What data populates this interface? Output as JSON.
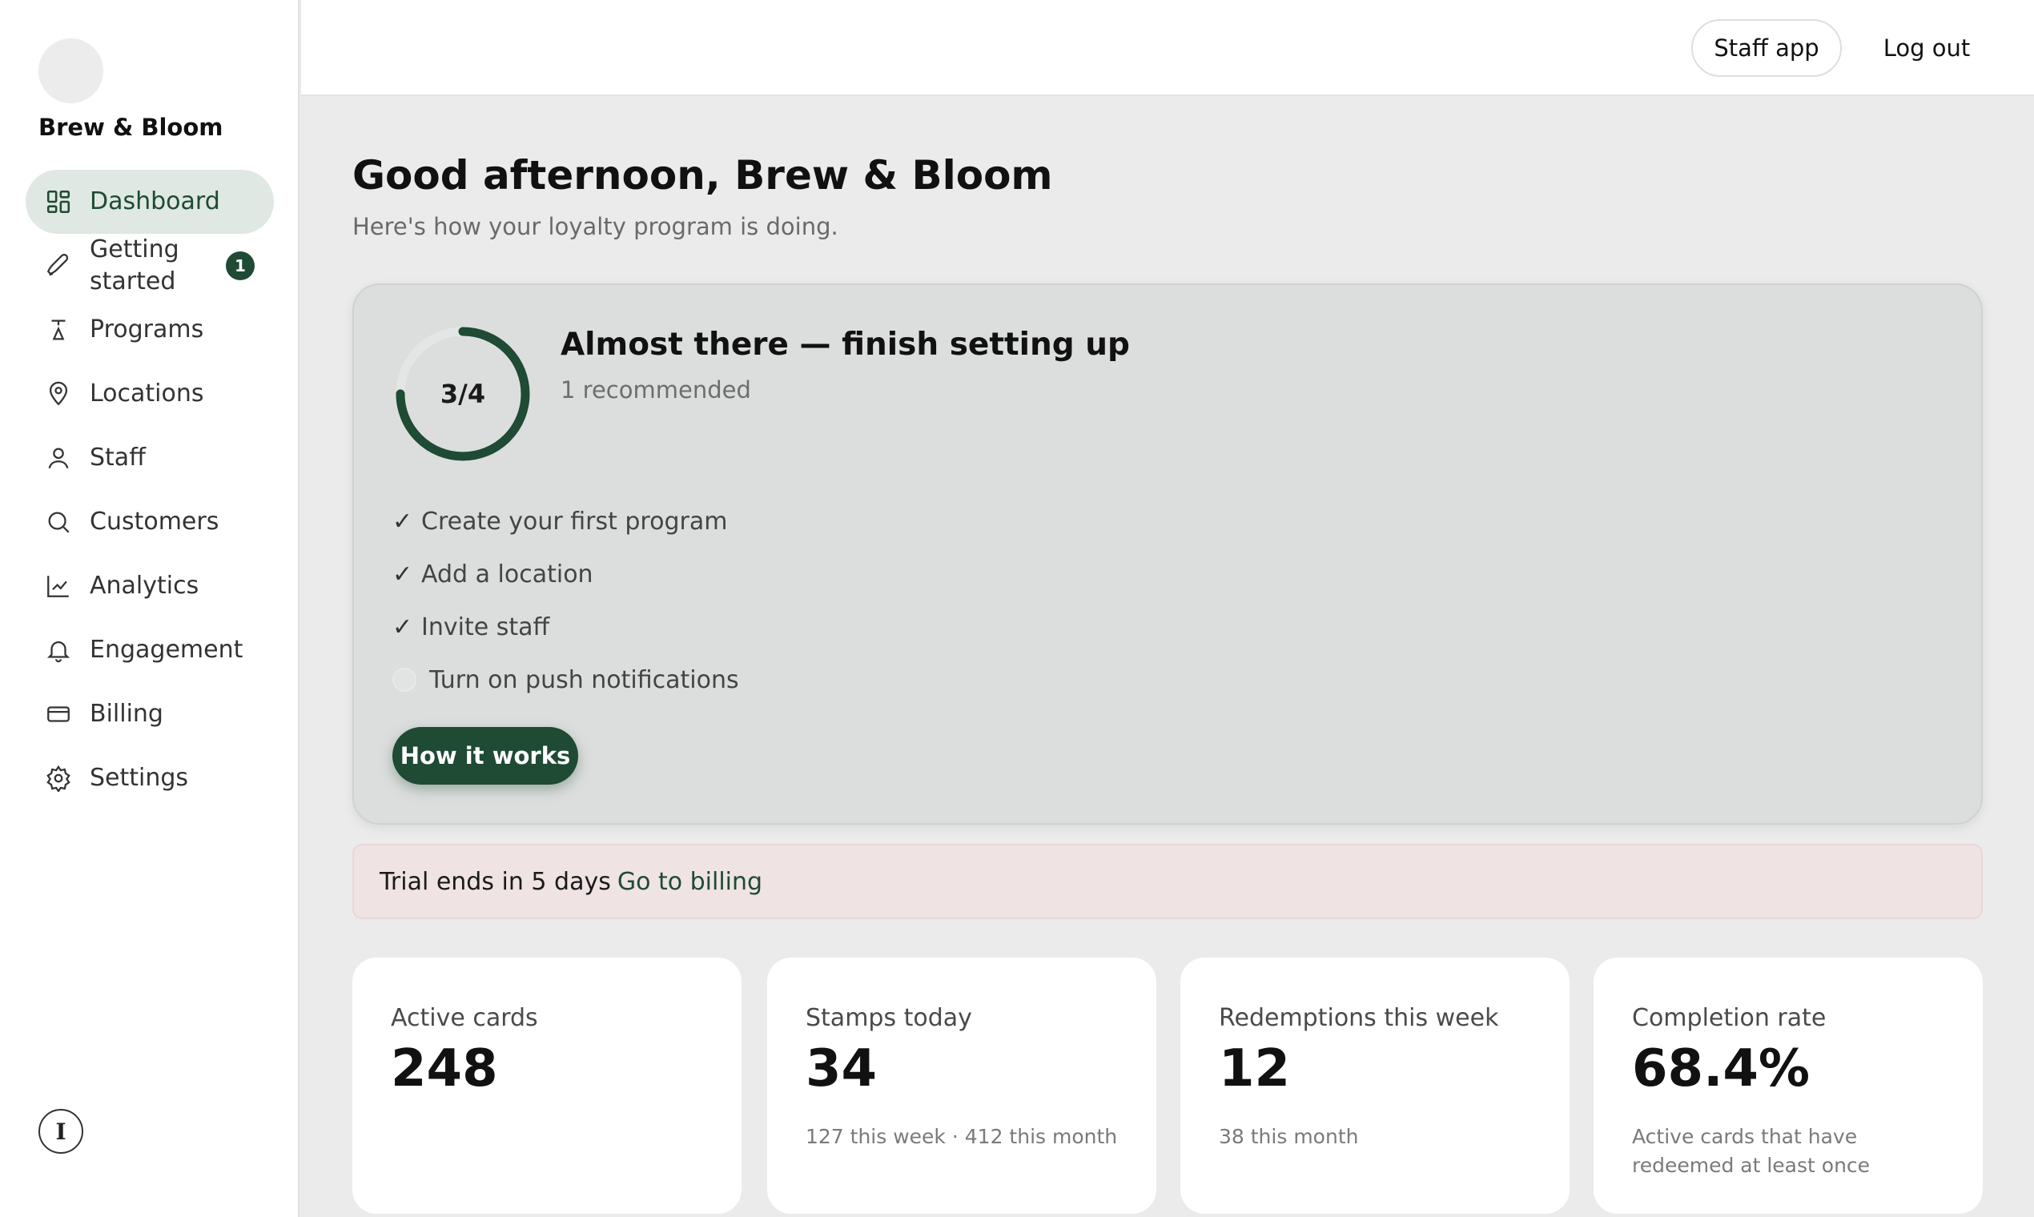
{
  "brand": {
    "name": "Brew & Bloom"
  },
  "sidebar": {
    "items": [
      {
        "label": "Dashboard",
        "icon": "dashboard-icon",
        "active": true
      },
      {
        "label": "Getting started",
        "icon": "rocket-icon",
        "badge": "1"
      },
      {
        "label": "Programs",
        "icon": "programs-icon"
      },
      {
        "label": "Locations",
        "icon": "location-pin-icon"
      },
      {
        "label": "Staff",
        "icon": "user-icon"
      },
      {
        "label": "Customers",
        "icon": "search-icon"
      },
      {
        "label": "Analytics",
        "icon": "line-chart-icon"
      },
      {
        "label": "Engagement",
        "icon": "bell-icon"
      },
      {
        "label": "Billing",
        "icon": "credit-card-icon"
      },
      {
        "label": "Settings",
        "icon": "gear-icon"
      }
    ],
    "footer_logo": "I"
  },
  "topbar": {
    "staff_app": "Staff app",
    "logout": "Log out"
  },
  "main": {
    "greeting": "Good afternoon, Brew & Bloom",
    "subtitle": "Here's how your loyalty program is doing."
  },
  "setup": {
    "progress_text": "3/4",
    "progress_fraction": 0.75,
    "title": "Almost there — finish setting up",
    "subtitle": "1 recommended",
    "steps": [
      {
        "label": "Create your first program",
        "done": true
      },
      {
        "label": "Add a location",
        "done": true
      },
      {
        "label": "Invite staff",
        "done": true
      },
      {
        "label": "Turn on push notifications",
        "done": false
      }
    ],
    "check_glyph": "✓",
    "button": "How it works"
  },
  "trial": {
    "text": "Trial ends in 5 days",
    "link": "Go to billing"
  },
  "stats": [
    {
      "label": "Active cards",
      "value": "248",
      "note": ""
    },
    {
      "label": "Stamps today",
      "value": "34",
      "note": "127 this week · 412 this month"
    },
    {
      "label": "Redemptions this week",
      "value": "12",
      "note": "38 this month"
    },
    {
      "label": "Completion rate",
      "value": "68.4%",
      "note": "Active cards that have redeemed at least once"
    }
  ],
  "colors": {
    "accent": "#1f4a33",
    "accent_light": "#dfe8e2",
    "banner": "#efe3e3"
  }
}
